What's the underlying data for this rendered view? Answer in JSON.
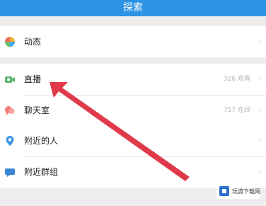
{
  "header": {
    "title": "探索"
  },
  "items": [
    {
      "label": "动态",
      "meta": "",
      "icon": "pinwheel-icon"
    },
    {
      "label": "直播",
      "meta": "326 观看",
      "icon": "video-camera-icon"
    },
    {
      "label": "聊天室",
      "meta": "757 在线",
      "icon": "chat-room-icon"
    },
    {
      "label": "附近的人",
      "meta": "",
      "icon": "location-pin-icon"
    },
    {
      "label": "附近群组",
      "meta": "",
      "icon": "group-chat-icon"
    }
  ],
  "watermark": {
    "text": "玩游下载网"
  },
  "colors": {
    "header": "#2c93e5",
    "arrow": "#e03a4a"
  }
}
